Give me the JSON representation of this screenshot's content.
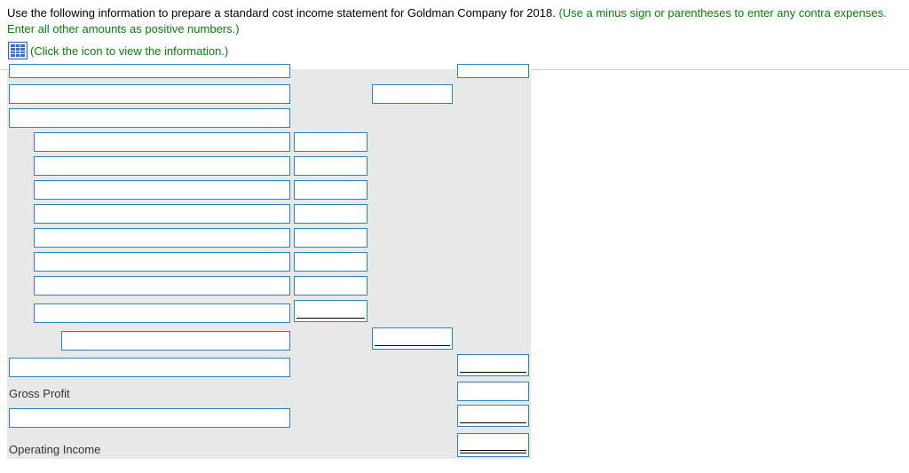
{
  "instructions": {
    "main": "Use the following information to prepare a standard cost income statement for Goldman Company for 2018.",
    "green": "(Use a minus sign or parentheses to enter any contra expenses. Enter all other amounts as positive numbers.)"
  },
  "info_link": {
    "text": "(Click the icon to view the information.)",
    "icon": "table-icon"
  },
  "statement": {
    "gross_profit_label": "Gross Profit",
    "operating_income_label": "Operating Income"
  },
  "colors": {
    "instruction_green": "#0a7f0a",
    "field_border": "#2c86b9",
    "panel_bg": "#e8e8e8"
  }
}
